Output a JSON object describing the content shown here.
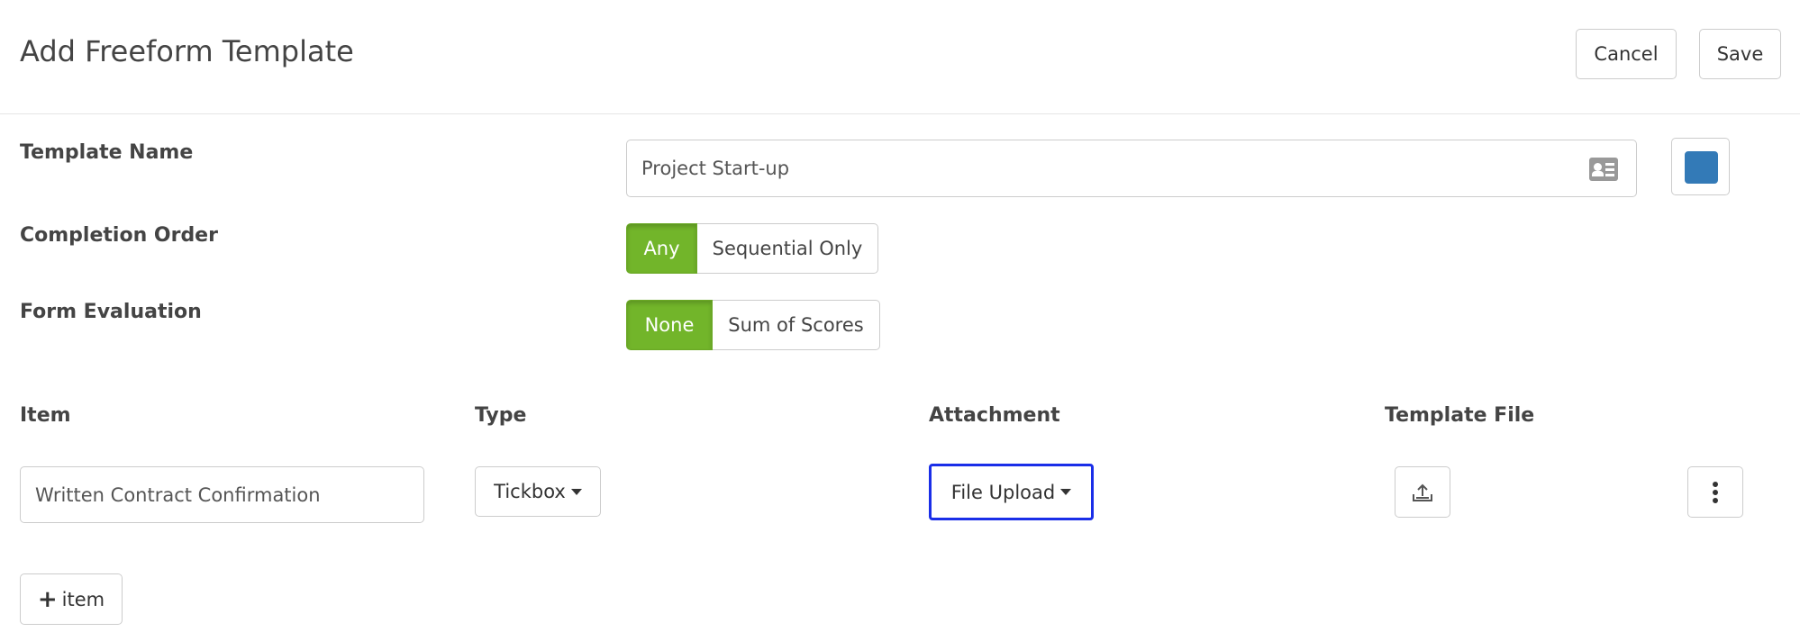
{
  "header": {
    "title": "Add Freeform Template",
    "cancel_label": "Cancel",
    "save_label": "Save"
  },
  "form": {
    "template_name": {
      "label": "Template Name",
      "value": "Project Start-up",
      "icon": "contact-card-icon",
      "color_swatch": "#337ab7"
    },
    "completion_order": {
      "label": "Completion Order",
      "options": [
        "Any",
        "Sequential Only"
      ],
      "selected": "Any"
    },
    "form_evaluation": {
      "label": "Form Evaluation",
      "options": [
        "None",
        "Sum of Scores"
      ],
      "selected": "None"
    }
  },
  "items_table": {
    "columns": [
      "Item",
      "Type",
      "Attachment",
      "Template File"
    ],
    "rows": [
      {
        "item": "Written Contract Confirmation",
        "type": "Tickbox",
        "attachment": "File Upload",
        "template_file_icon": "upload-icon",
        "menu_icon": "vertical-ellipsis-icon"
      }
    ],
    "add_label": "item"
  },
  "colors": {
    "active_toggle": "#72b52a",
    "focus_border": "#1a2ee8",
    "swatch": "#337ab7"
  }
}
